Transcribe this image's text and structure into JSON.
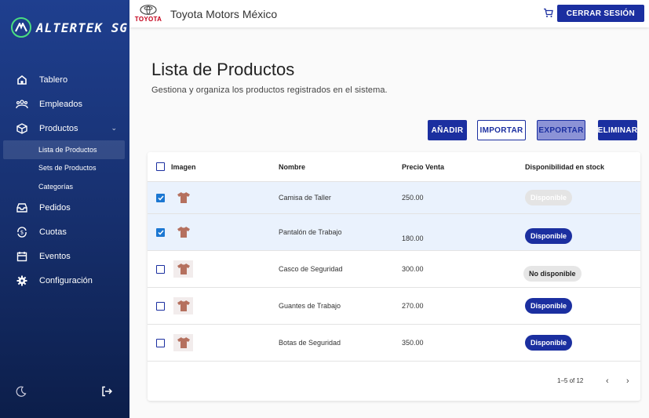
{
  "brand": {
    "logo_text": "ALTERTEK SG"
  },
  "sidebar": {
    "items": [
      {
        "label": "Tablero",
        "icon": "home-icon"
      },
      {
        "label": "Empleados",
        "icon": "people-icon"
      },
      {
        "label": "Productos",
        "icon": "box-icon"
      },
      {
        "label": "Pedidos",
        "icon": "inbox-icon"
      },
      {
        "label": "Cuotas",
        "icon": "dollar-cycle-icon"
      },
      {
        "label": "Eventos",
        "icon": "calendar-icon"
      },
      {
        "label": "Configuración",
        "icon": "gear-icon"
      }
    ],
    "subitems": [
      {
        "label": "Lista de Productos",
        "active": true
      },
      {
        "label": "Sets de Productos"
      },
      {
        "label": "Categorías"
      }
    ]
  },
  "header": {
    "company_logo_text": "TOYOTA",
    "title": "Toyota Motors México",
    "logout_label": "CERRAR SESIÓN"
  },
  "main": {
    "title": "Lista de Productos",
    "subtitle": "Gestiona y organiza los productos registrados en el sistema.",
    "actions": {
      "add": "AÑADIR",
      "import": "IMPORTAR",
      "export": "EXPORTAR",
      "delete": "ELIMINAR"
    }
  },
  "table": {
    "columns": [
      "Imagen",
      "Nombre",
      "Precio Venta",
      "Disponibilidad en stock"
    ],
    "rows": [
      {
        "name": "Camisa de Taller",
        "price": "250.00",
        "stock": "Disponible",
        "checked": true
      },
      {
        "name": "Pantalón de Trabajo",
        "price": "180.00",
        "stock": "Disponible",
        "checked": true
      },
      {
        "name": "Casco de Seguridad",
        "price": "300.00",
        "stock": "No disponible",
        "checked": false
      },
      {
        "name": "Guantes de Trabajo",
        "price": "270.00",
        "stock": "Disponible",
        "checked": false
      },
      {
        "name": "Botas de Seguridad",
        "price": "350.00",
        "stock": "Disponible",
        "checked": false
      }
    ],
    "pagination": {
      "range": "1–5 of 12",
      "prev": "‹",
      "next": "›"
    }
  },
  "colors": {
    "primary": "#1b2fa0",
    "sidebar": "#1f3f8f",
    "selected_row": "#eaf2fd",
    "logo_accent": "#4ade80"
  }
}
